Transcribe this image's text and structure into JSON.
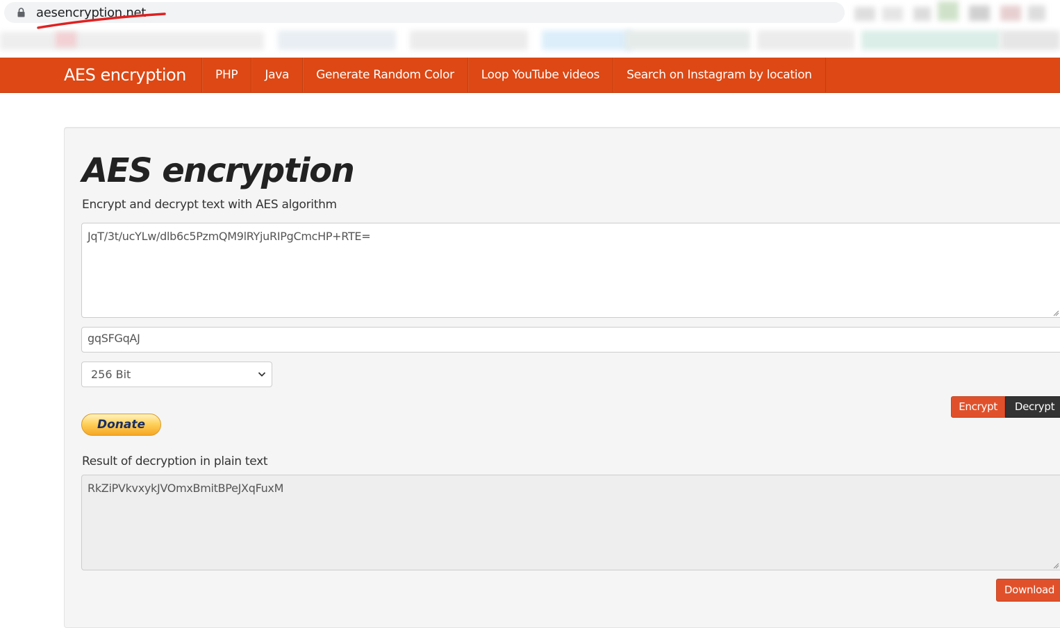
{
  "browser": {
    "url": "aesencryption.net"
  },
  "navbar": {
    "brand": "AES encryption",
    "items": [
      {
        "label": "PHP"
      },
      {
        "label": "Java"
      },
      {
        "label": "Generate Random Color"
      },
      {
        "label": "Loop YouTube videos"
      },
      {
        "label": "Search on Instagram by location"
      }
    ]
  },
  "main": {
    "title": "AES encryption",
    "subtitle": "Encrypt and decrypt text with AES algorithm",
    "input_text": "JqT/3t/ucYLw/dlb6c5PzmQM9lRYjuRIPgCmcHP+RTE=",
    "key": "gqSFGqAJ",
    "key_size": {
      "selected": "256 Bit"
    },
    "encrypt_label": "Encrypt",
    "decrypt_label": "Decrypt",
    "donate_label": "Donate",
    "result_label": "Result of decryption in plain text",
    "result_text": "RkZiPVkvxykJVOmxBmitBPeJXqFuxM",
    "download_label": "Download"
  },
  "colors": {
    "navbar": "#dd4814",
    "encrypt_button": "#e0512b",
    "decrypt_button": "#333333",
    "annotation_underline": "#e02020"
  }
}
